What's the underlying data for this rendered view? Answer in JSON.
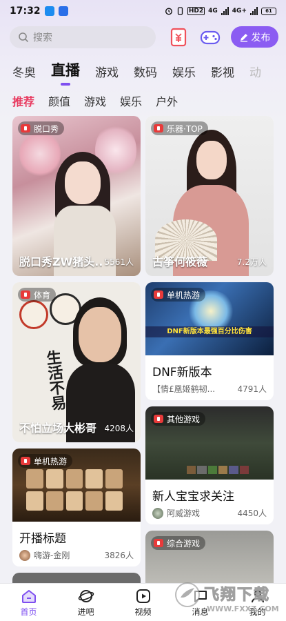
{
  "status_bar": {
    "time": "17:32",
    "hd": "HD2",
    "net1": "4G",
    "net2": "4G+",
    "battery": "61"
  },
  "search": {
    "placeholder": "搜索"
  },
  "header": {
    "publish_label": "发布"
  },
  "categories": [
    "冬奥",
    "直播",
    "游戏",
    "数码",
    "娱乐",
    "影视",
    "动"
  ],
  "active_category": "直播",
  "sub_categories": [
    "推荐",
    "颜值",
    "游戏",
    "娱乐",
    "户外"
  ],
  "cards": [
    {
      "tag": "脱口秀",
      "title": "脱口秀ZW猪头...",
      "count": "5561人"
    },
    {
      "tag": "乐器·TOP",
      "title": "古筝何筱薇",
      "count": "7.2万人"
    },
    {
      "tag": "体育",
      "title": "不怕立场大彬哥",
      "count": "4208人",
      "thumb_text": "生活不易"
    },
    {
      "tag": "单机热游",
      "title": "DNF新版本",
      "author": "【情£凰姬鹤韧...",
      "count": "4791人",
      "thumb_text": "DNF新版本最强百分比伤害"
    },
    {
      "tag": "其他游戏",
      "title": "新人宝宝求关注",
      "author": "阿威游戏",
      "count": "4450人"
    },
    {
      "tag": "单机热游",
      "title": "开播标题",
      "author": "嗨游-金刚",
      "count": "3826人"
    },
    {
      "tag": "综合游戏"
    }
  ],
  "bottom_nav": [
    {
      "label": "首页",
      "icon": "home-icon"
    },
    {
      "label": "进吧",
      "icon": "planet-icon"
    },
    {
      "label": "视频",
      "icon": "video-icon"
    },
    {
      "label": "消息",
      "icon": "message-icon"
    },
    {
      "label": "我的",
      "icon": "profile-icon"
    }
  ],
  "watermark": {
    "text": "飞翔下载",
    "url": "WWW.FXXZ.COM"
  },
  "colors": {
    "accent": "#7e4ef0",
    "publish": "#8b5cf2",
    "sub_active": "#e83a5f",
    "live_red": "#e83a3a"
  }
}
